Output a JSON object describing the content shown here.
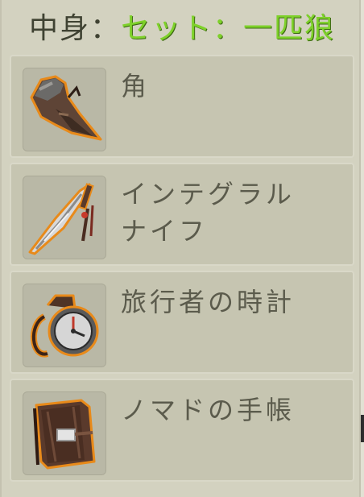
{
  "header": {
    "prefix": "中身：",
    "set_name": "セット：一匹狼"
  },
  "items": [
    {
      "name": "角",
      "icon": "horn-icon"
    },
    {
      "name": "インテグラル\nナイフ",
      "icon": "integral-knife-icon"
    },
    {
      "name": "旅行者の時計",
      "icon": "travelers-watch-icon"
    },
    {
      "name": "ノマドの手帳",
      "icon": "nomad-notebook-icon"
    }
  ],
  "colors": {
    "panel_bg": "#d3d2c0",
    "slot_bg": "#c6c5b1",
    "header_text": "#3f4232",
    "set_name_green": "#7ed12a",
    "item_text": "#5b5b4c",
    "item_outline_orange": "#e88a1a"
  }
}
